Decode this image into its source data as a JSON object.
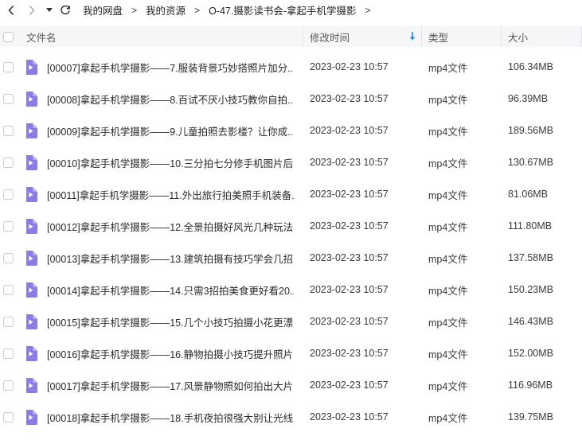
{
  "nav": {
    "breadcrumbs": [
      "我的网盘",
      "我的资源",
      "O-47.摄影读书会-拿起手机学摄影"
    ],
    "separator": ">"
  },
  "table": {
    "headers": {
      "name": "文件名",
      "time": "修改时间",
      "type": "类型",
      "size": "大小"
    },
    "sort_icon": "arrow-down-icon",
    "accent_color": "#2f80ed",
    "file_icon_color": "#8a7be6",
    "rows": [
      {
        "name": "[00007]拿起手机学摄影——7.服装背景巧妙搭照片加分...",
        "time": "2023-02-23 10:57",
        "type": "mp4文件",
        "size": "106.34MB"
      },
      {
        "name": "[00008]拿起手机学摄影——8.百试不厌小技巧教你自拍...",
        "time": "2023-02-23 10:57",
        "type": "mp4文件",
        "size": "96.39MB"
      },
      {
        "name": "[00009]拿起手机学摄影——9.儿童拍照去影楼？让你成...",
        "time": "2023-02-23 10:57",
        "type": "mp4文件",
        "size": "189.56MB"
      },
      {
        "name": "[00010]拿起手机学摄影——10.三分拍七分修手机图片后...",
        "time": "2023-02-23 10:57",
        "type": "mp4文件",
        "size": "130.67MB"
      },
      {
        "name": "[00011]拿起手机学摄影——11.外出旅行拍美照手机装备...",
        "time": "2023-02-23 10:57",
        "type": "mp4文件",
        "size": "81.06MB"
      },
      {
        "name": "[00012]拿起手机学摄影——12.全景拍摄好风光几种玩法...",
        "time": "2023-02-23 10:57",
        "type": "mp4文件",
        "size": "111.80MB"
      },
      {
        "name": "[00013]拿起手机学摄影——13.建筑拍摄有技巧学会几招...",
        "time": "2023-02-23 10:57",
        "type": "mp4文件",
        "size": "137.58MB"
      },
      {
        "name": "[00014]拿起手机学摄影——14.只需3招拍美食更好看20...",
        "time": "2023-02-23 10:57",
        "type": "mp4文件",
        "size": "150.23MB"
      },
      {
        "name": "[00015]拿起手机学摄影——15.几个小技巧拍摄小花更漂...",
        "time": "2023-02-23 10:57",
        "type": "mp4文件",
        "size": "146.43MB"
      },
      {
        "name": "[00016]拿起手机学摄影——16.静物拍摄小技巧提升照片...",
        "time": "2023-02-23 10:57",
        "type": "mp4文件",
        "size": "152.00MB"
      },
      {
        "name": "[00017]拿起手机学摄影——17.风景静物照如何拍出大片...",
        "time": "2023-02-23 10:57",
        "type": "mp4文件",
        "size": "116.96MB"
      },
      {
        "name": "[00018]拿起手机学摄影——18.手机夜拍很强大别让光线...",
        "time": "2023-02-23 10:57",
        "type": "mp4文件",
        "size": "139.75MB"
      }
    ]
  }
}
